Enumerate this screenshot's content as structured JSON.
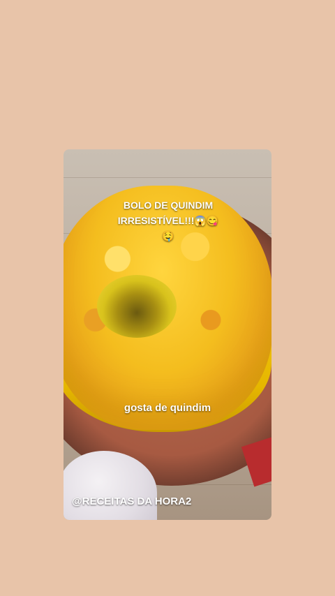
{
  "story": {
    "title_line1": "BOLO DE QUINDIM",
    "title_line2": "IRRESISTÍVEL!!!😱😋",
    "title_line3": "🤤",
    "middle_text": "gosta de quindim",
    "handle": "@RECEITAS DA HORA2"
  },
  "colors": {
    "background": "#e8c4a9",
    "cake": "#f4bd1e",
    "plate": "#a75a42",
    "text": "#ffffff"
  }
}
